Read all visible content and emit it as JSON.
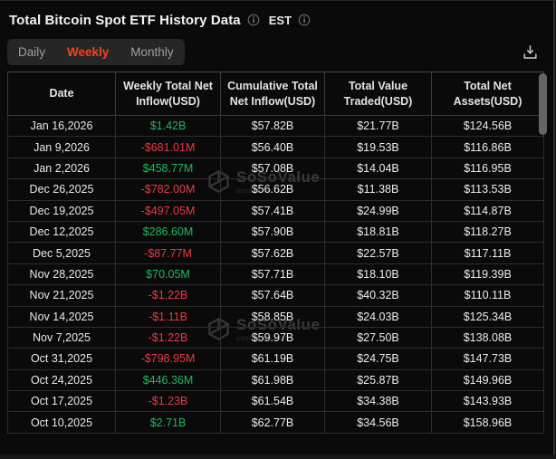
{
  "header": {
    "title": "Total Bitcoin Spot ETF History Data",
    "timezone": "EST",
    "title_info_icon": "info-circle",
    "est_info_icon": "info-circle"
  },
  "tabs": [
    {
      "label": "Daily",
      "active": false
    },
    {
      "label": "Weekly",
      "active": true
    },
    {
      "label": "Monthly",
      "active": false
    }
  ],
  "toolbar": {
    "download_icon": "download-tray-arrow"
  },
  "table": {
    "columns": [
      "Date",
      "Weekly Total Net Inflow(USD)",
      "Cumulative Total Net Inflow(USD)",
      "Total Value Traded(USD)",
      "Total Net Assets(USD)"
    ],
    "rows": [
      {
        "date": "Jan 16,2026",
        "weekly_inflow": "$1.42B",
        "cumulative_inflow": "$57.82B",
        "value_traded": "$21.77B",
        "net_assets": "$124.56B"
      },
      {
        "date": "Jan 9,2026",
        "weekly_inflow": "-$681.01M",
        "cumulative_inflow": "$56.40B",
        "value_traded": "$19.53B",
        "net_assets": "$116.86B"
      },
      {
        "date": "Jan 2,2026",
        "weekly_inflow": "$458.77M",
        "cumulative_inflow": "$57.08B",
        "value_traded": "$14.04B",
        "net_assets": "$116.95B"
      },
      {
        "date": "Dec 26,2025",
        "weekly_inflow": "-$782.00M",
        "cumulative_inflow": "$56.62B",
        "value_traded": "$11.38B",
        "net_assets": "$113.53B"
      },
      {
        "date": "Dec 19,2025",
        "weekly_inflow": "-$497.05M",
        "cumulative_inflow": "$57.41B",
        "value_traded": "$24.99B",
        "net_assets": "$114.87B"
      },
      {
        "date": "Dec 12,2025",
        "weekly_inflow": "$286.60M",
        "cumulative_inflow": "$57.90B",
        "value_traded": "$18.81B",
        "net_assets": "$118.27B"
      },
      {
        "date": "Dec 5,2025",
        "weekly_inflow": "-$87.77M",
        "cumulative_inflow": "$57.62B",
        "value_traded": "$22.57B",
        "net_assets": "$117.11B"
      },
      {
        "date": "Nov 28,2025",
        "weekly_inflow": "$70.05M",
        "cumulative_inflow": "$57.71B",
        "value_traded": "$18.10B",
        "net_assets": "$119.39B"
      },
      {
        "date": "Nov 21,2025",
        "weekly_inflow": "-$1.22B",
        "cumulative_inflow": "$57.64B",
        "value_traded": "$40.32B",
        "net_assets": "$110.11B"
      },
      {
        "date": "Nov 14,2025",
        "weekly_inflow": "-$1.11B",
        "cumulative_inflow": "$58.85B",
        "value_traded": "$24.03B",
        "net_assets": "$125.34B"
      },
      {
        "date": "Nov 7,2025",
        "weekly_inflow": "-$1.22B",
        "cumulative_inflow": "$59.97B",
        "value_traded": "$27.50B",
        "net_assets": "$138.08B"
      },
      {
        "date": "Oct 31,2025",
        "weekly_inflow": "-$798.95M",
        "cumulative_inflow": "$61.19B",
        "value_traded": "$24.75B",
        "net_assets": "$147.73B"
      },
      {
        "date": "Oct 24,2025",
        "weekly_inflow": "$446.36M",
        "cumulative_inflow": "$61.98B",
        "value_traded": "$25.87B",
        "net_assets": "$149.96B"
      },
      {
        "date": "Oct 17,2025",
        "weekly_inflow": "-$1.23B",
        "cumulative_inflow": "$61.54B",
        "value_traded": "$34.38B",
        "net_assets": "$143.93B"
      },
      {
        "date": "Oct 10,2025",
        "weekly_inflow": "$2.71B",
        "cumulative_inflow": "$62.77B",
        "value_traded": "$34.56B",
        "net_assets": "$158.96B"
      }
    ]
  },
  "watermark": {
    "brand": "SoSoValue",
    "domain": "sosovalue.com"
  },
  "colors": {
    "accent": "#f04324",
    "positive": "#1dba58",
    "negative": "#ea3943"
  }
}
